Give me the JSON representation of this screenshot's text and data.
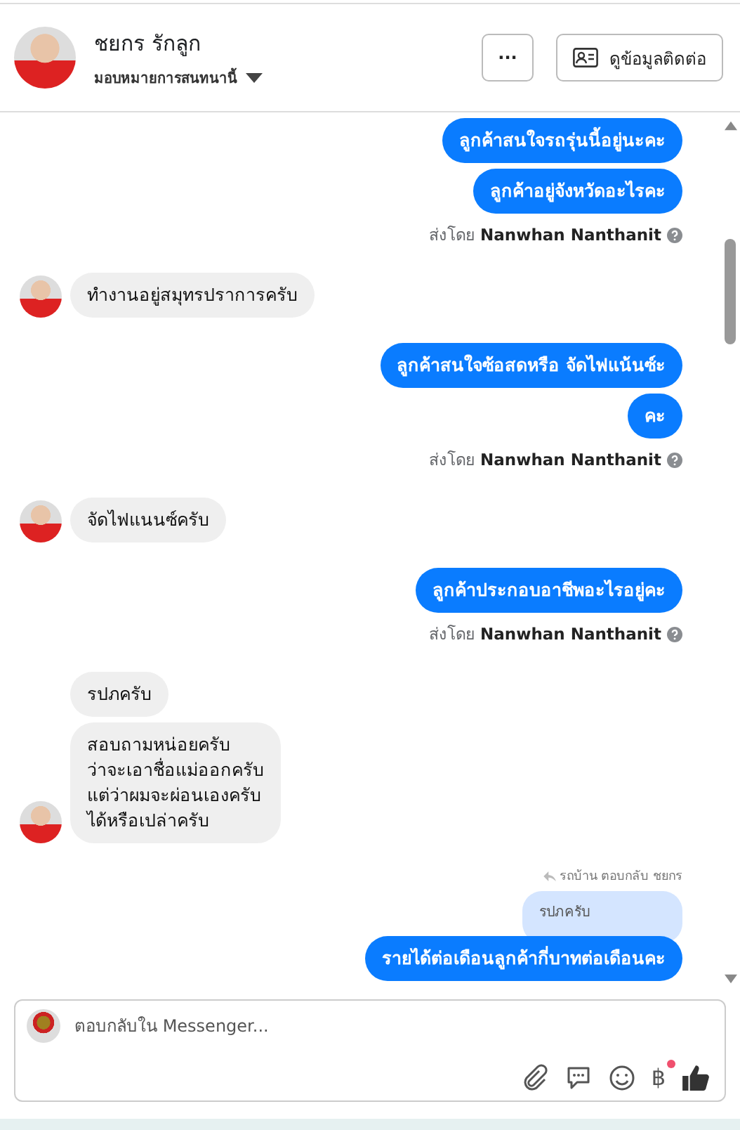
{
  "header": {
    "name": "ชยกร รักลูก",
    "assign": "มอบหมายการสนทนานี้",
    "more_button": "···",
    "contact_button": "ดูข้อมูลติดต่อ"
  },
  "messages": [
    {
      "kind": "out",
      "text": "ลูกค้าสนใจรถรุ่นนี้อยู่นะคะ"
    },
    {
      "kind": "out",
      "text": "ลูกค้าอยู่จังหวัดอะไรคะ"
    },
    {
      "kind": "sentby",
      "prefix": "ส่งโดย",
      "name": "Nanwhan Nanthanit"
    },
    {
      "kind": "in",
      "text": "ทำงานอยู่สมุทรปราการครับ",
      "avatar": true
    },
    {
      "kind": "out",
      "text": "ลูกค้าสนใจซ้อสดหรือ จัดไฟแน้นซ์ะ"
    },
    {
      "kind": "out",
      "text": "คะ"
    },
    {
      "kind": "sentby",
      "prefix": "ส่งโดย",
      "name": "Nanwhan Nanthanit"
    },
    {
      "kind": "in",
      "text": "จัดไฟแนนซ์ครับ",
      "avatar": true
    },
    {
      "kind": "out",
      "text": "ลูกค้าประกอบอาชีพอะไรอยู่คะ"
    },
    {
      "kind": "sentby",
      "prefix": "ส่งโดย",
      "name": "Nanwhan Nanthanit"
    },
    {
      "kind": "in",
      "text": "รปภครับ",
      "avatar": false
    },
    {
      "kind": "in",
      "text": "สอบถามหน่อยครับ\nว่าจะเอาชื่อแม่ออกครับ\nแต่ว่าผมจะผ่อนเองครับ\nได้หรือเปล่าครับ",
      "avatar": true
    },
    {
      "kind": "reply",
      "text": "รถบ้าน ตอบกลับ ชยกร"
    },
    {
      "kind": "quote",
      "text": "รปภครับ"
    },
    {
      "kind": "out",
      "text": "รายได้ต่อเดือนลูกค้ากี่บาทต่อเดือนคะ"
    }
  ],
  "composer": {
    "placeholder": "ตอบกลับใน Messenger...",
    "currency": "฿",
    "currency_badge": true
  }
}
